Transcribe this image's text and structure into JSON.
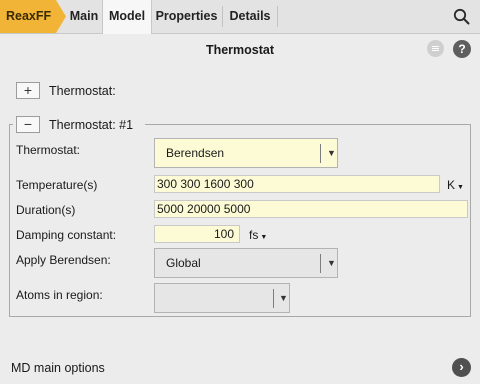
{
  "app_tab": "ReaxFF",
  "tabs": [
    {
      "label": "Main"
    },
    {
      "label": "Model"
    },
    {
      "label": "Properties"
    },
    {
      "label": "Details"
    }
  ],
  "panel": {
    "title": "Thermostat"
  },
  "add_section": {
    "button": "+",
    "label": "Thermostat:"
  },
  "group": {
    "button": "−",
    "title": "Thermostat: #1",
    "thermostat": {
      "label": "Thermostat:",
      "value": "Berendsen"
    },
    "temperature": {
      "label": "Temperature(s)",
      "value": "300 300 1600 300",
      "unit": "K"
    },
    "duration": {
      "label": "Duration(s)",
      "value": "5000 20000 5000"
    },
    "damping": {
      "label": "Damping constant:",
      "value": "100",
      "unit": "fs"
    },
    "apply": {
      "label": "Apply Berendsen:",
      "value": "Global"
    },
    "atoms": {
      "label": "Atoms in region:",
      "value": ""
    }
  },
  "footer": {
    "label": "MD main options"
  },
  "colors": {
    "accent": "#f2b437",
    "input_bg": "#fdfbd5",
    "combo_bg": "#fdfbd5",
    "disabled_bg": "#e6e6e6"
  },
  "icons": {
    "search": "search-icon",
    "menu": "menu-icon",
    "help": "help-icon",
    "next": "chevron-right-icon",
    "dropdown": "chevron-down-icon"
  }
}
